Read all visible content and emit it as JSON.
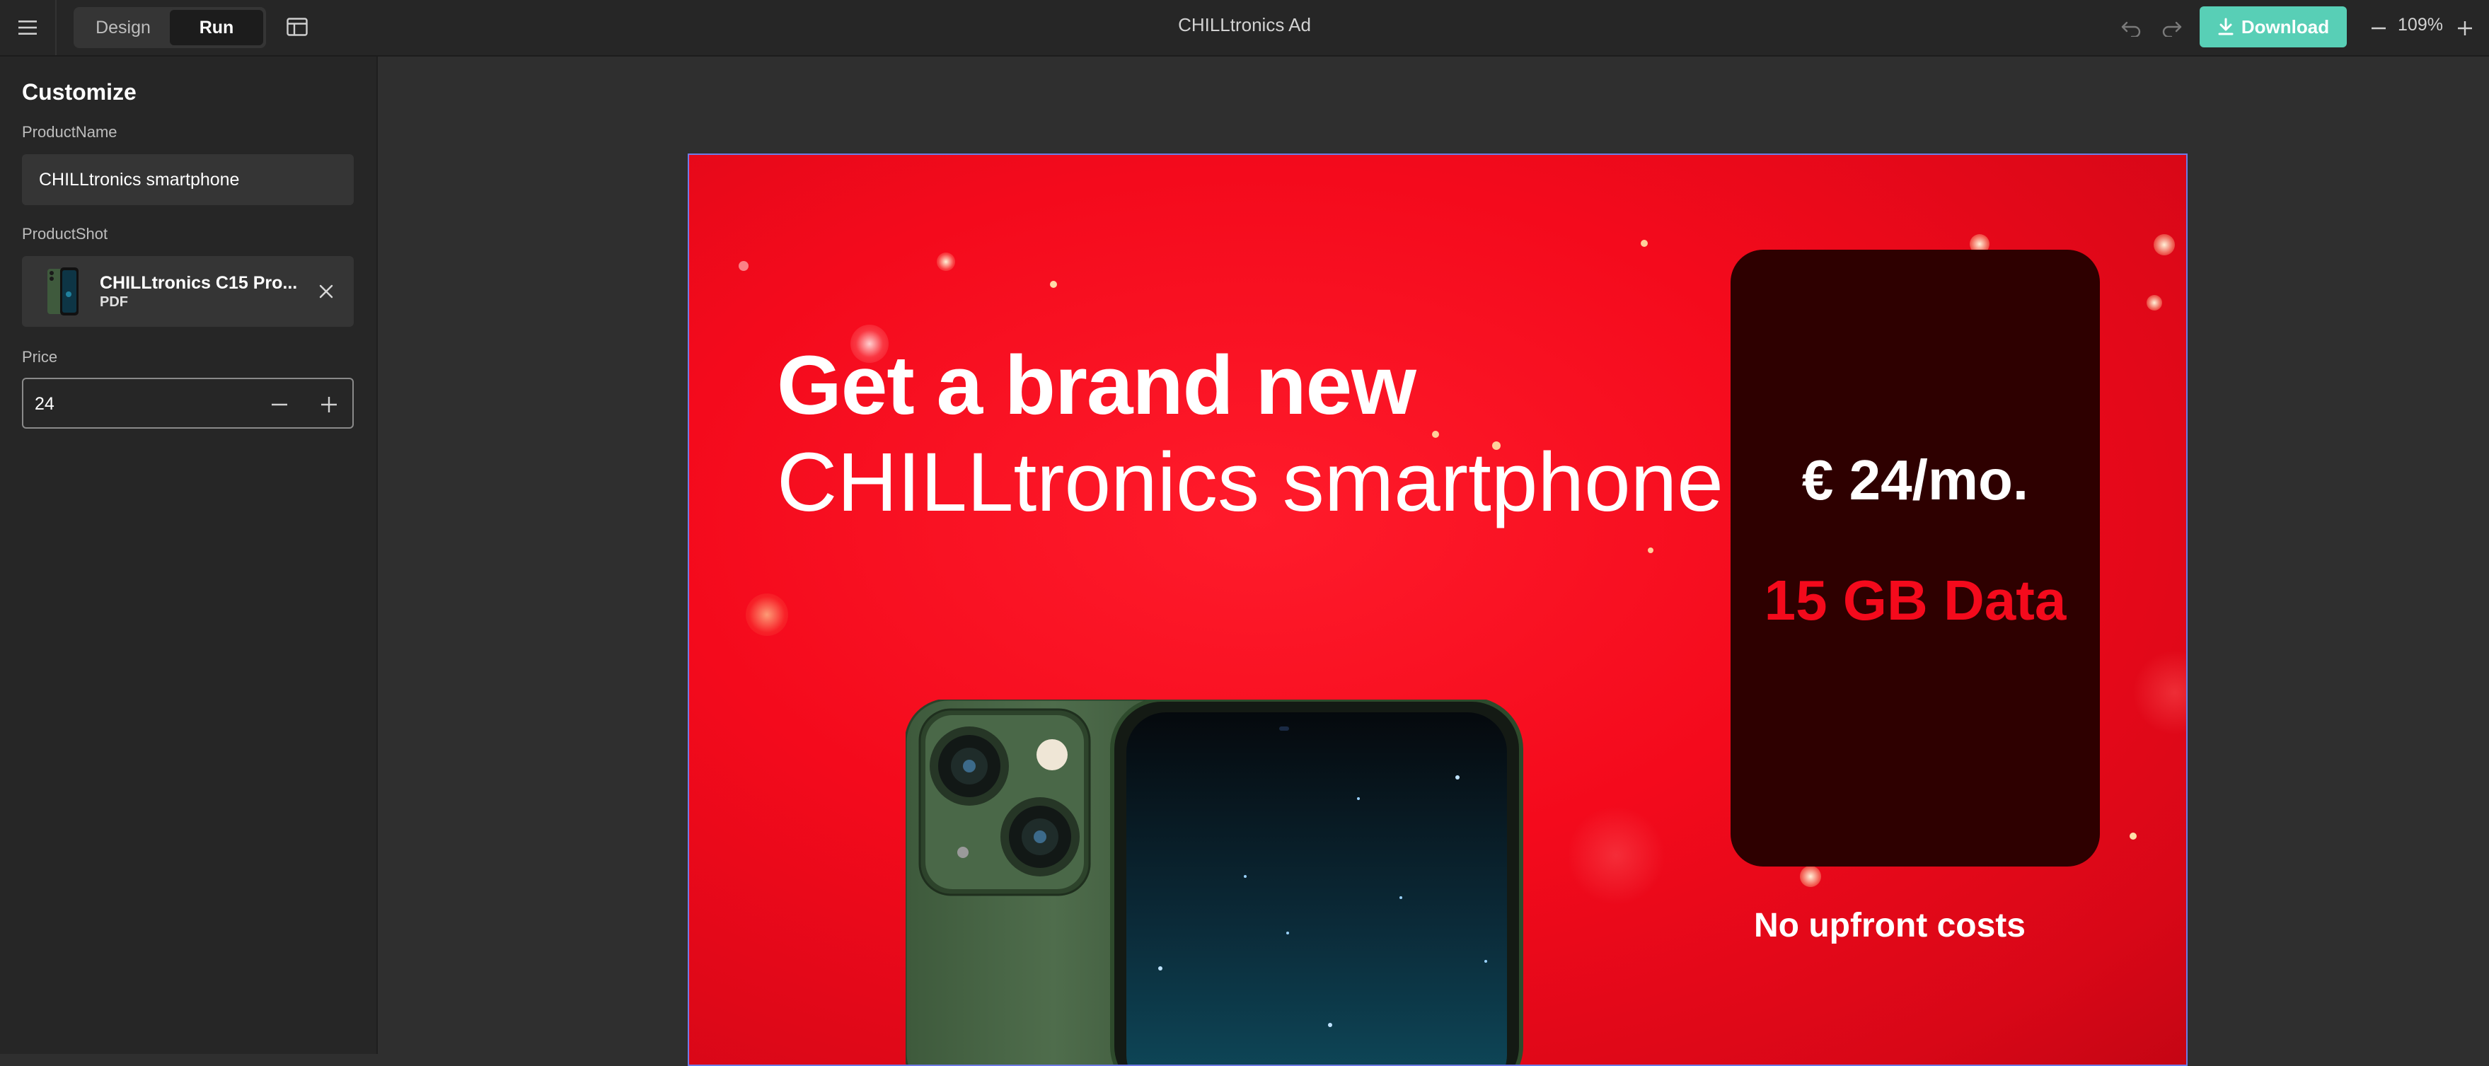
{
  "toolbar": {
    "modes": [
      "Design",
      "Run"
    ],
    "active_mode": "Run",
    "title": "CHILLtronics Ad",
    "download_label": "Download",
    "zoom": "109%"
  },
  "sidebar": {
    "title": "Customize",
    "product_name": {
      "label": "ProductName",
      "value": "CHILLtronics smartphone"
    },
    "product_shot": {
      "label": "ProductShot",
      "file_name": "CHILLtronics C15 Pro...",
      "file_type": "PDF"
    },
    "price": {
      "label": "Price",
      "value": "24"
    }
  },
  "ad": {
    "headline_line1": "Get a brand new",
    "headline_line2": "CHILLtronics smartphone",
    "price_text": "€ 24/mo.",
    "data_text": "15 GB Data",
    "upfront_text": "No upfront costs"
  },
  "colors": {
    "accent": "#58cfb6",
    "ad_background": "#f40a1c",
    "price_card": "#2e0000",
    "data_text": "#f40a1c",
    "phone_body": "#4d6b4b"
  },
  "icons": [
    "menu-icon",
    "layout-icon",
    "undo-icon",
    "redo-icon",
    "download-icon",
    "zoom-out-icon",
    "zoom-in-icon",
    "close-icon",
    "minus-icon",
    "plus-icon"
  ]
}
